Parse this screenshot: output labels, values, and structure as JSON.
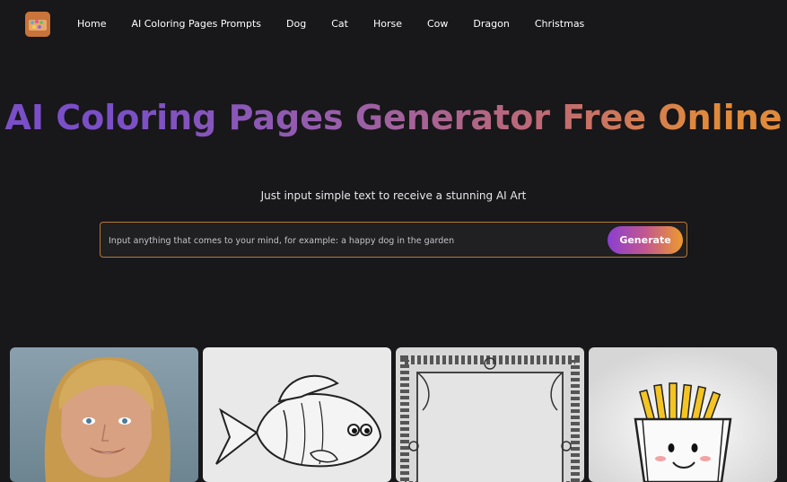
{
  "nav": {
    "logo_icon": "coloring-palette-logo",
    "links": [
      "Home",
      "AI Coloring Pages Prompts",
      "Dog",
      "Cat",
      "Horse",
      "Cow",
      "Dragon",
      "Christmas"
    ]
  },
  "hero": {
    "title": "AI Coloring Pages Generator Free Online",
    "subtitle": "Just input simple text to receive a stunning AI Art"
  },
  "prompt": {
    "placeholder": "Input anything that comes to your mind, for example: a happy dog in the garden",
    "value": "",
    "generate_label": "Generate"
  },
  "gallery": {
    "items": [
      "portrait-of-blonde-man",
      "fish-coloring-page",
      "ornate-floral-frame",
      "french-fries-character"
    ]
  },
  "colors": {
    "background": "#18171a",
    "title_gradient_start": "#7a4fc7",
    "title_gradient_end": "#e08a3c",
    "input_border": "#b9782e",
    "button_gradient_start": "#8a3fd2",
    "button_gradient_end": "#ee9a2e"
  }
}
